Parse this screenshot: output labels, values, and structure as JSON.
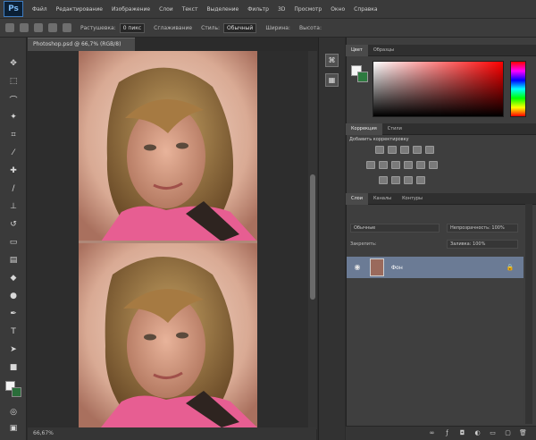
{
  "app": {
    "logo": "Ps"
  },
  "menubar": {
    "items": [
      "Файл",
      "Редактирование",
      "Изображение",
      "Слои",
      "Текст",
      "Выделение",
      "Фильтр",
      "3D",
      "Просмотр",
      "Окно",
      "Справка"
    ]
  },
  "options": {
    "label1": "Растушевка:",
    "field1": "0 пикс",
    "label2": "Сглаживание",
    "label3": "Стиль:",
    "field2": "Обычный",
    "label4": "Ширина:",
    "label5": "Высота:"
  },
  "document": {
    "tab": "Photoshop.psd @ 66,7% (RGB/8)",
    "status": "66,67%"
  },
  "panels": {
    "color_tabs": [
      "Цвет",
      "Образцы"
    ],
    "adjust_tabs": [
      "Коррекция",
      "Стили"
    ],
    "adjust_title": "Добавить корректировку",
    "layer_tabs": [
      "Слои",
      "Каналы",
      "Контуры"
    ],
    "layer_mode": "Обычные",
    "layer_opacity": "Непрозрачность: 100%",
    "layer_lock": "Закрепить:",
    "layer_fill": "Заливка: 100%",
    "layer_name": "Фон"
  },
  "colors": {
    "foreground": "#f4f4f4",
    "background": "#2a6e3a",
    "selected_layer": "#6b7b95"
  }
}
